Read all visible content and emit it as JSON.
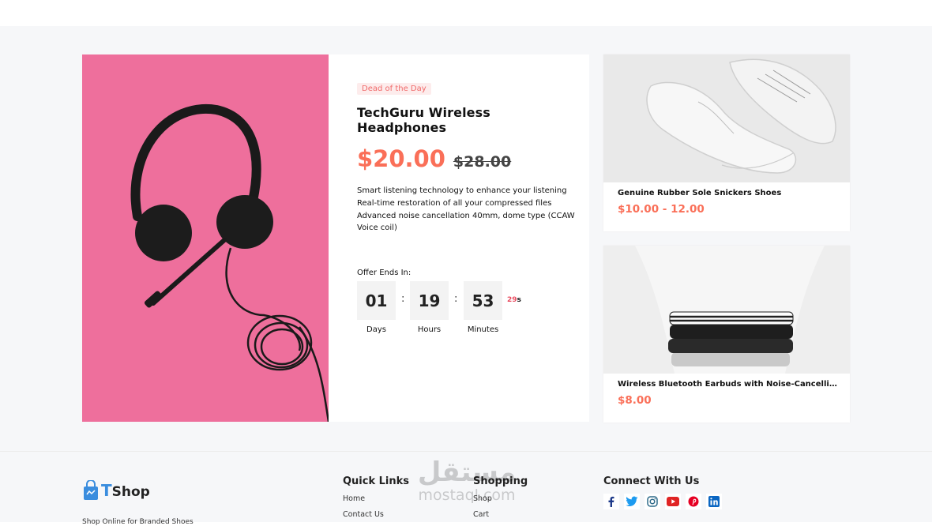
{
  "deal": {
    "badge": "Dead of the Day",
    "title": "TechGuru Wireless Headphones",
    "price_now": "$20.00",
    "price_was": "$28.00",
    "description": [
      "Smart listening technology to enhance your listening",
      "Real-time restoration of all your compressed files",
      "Advanced noise cancellation 40mm, dome type (CCAW",
      "Voice coil)"
    ],
    "offer_label": "Offer Ends In:",
    "countdown": {
      "days": "01",
      "hours": "19",
      "minutes": "53",
      "seconds": "29",
      "seconds_unit": "s",
      "days_label": "Days",
      "hours_label": "Hours",
      "minutes_label": "Minutes"
    }
  },
  "products": [
    {
      "name": "Genuine Rubber Sole Snickers Shoes",
      "price": "$10.00 - 12.00"
    },
    {
      "name": "Wireless Bluetooth Earbuds with Noise-Cancelling Tec...",
      "price": "$8.00"
    }
  ],
  "footer": {
    "logo_t": "T",
    "logo_rest": "Shop",
    "tagline": "Shop Online for Branded Shoes",
    "quick_links": {
      "title": "Quick Links",
      "items": [
        "Home",
        "Contact Us"
      ]
    },
    "shopping": {
      "title": "Shopping",
      "items": [
        "Shop",
        "Cart"
      ]
    },
    "connect": {
      "title": "Connect With Us"
    },
    "social_icons": [
      "facebook-icon",
      "twitter-icon",
      "instagram-icon",
      "youtube-icon",
      "pinterest-icon",
      "linkedin-icon"
    ],
    "watermark_arabic": "مستقل",
    "watermark_latin": "mostaql.com"
  },
  "colors": {
    "accent": "#fa6f58",
    "badge_bg": "#fdecec",
    "headphone_bg": "#ee6f9c",
    "seconds": "#e84b5f"
  }
}
